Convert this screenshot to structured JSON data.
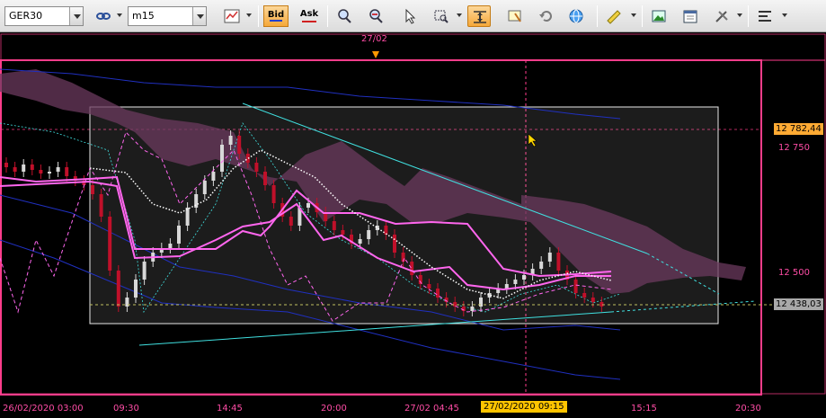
{
  "toolbar": {
    "symbol": "GER30",
    "timeframe": "m15",
    "bid_label": "Bid",
    "ask_label": "Ask",
    "icons": [
      "link-icon",
      "chart-type-icon",
      "crosshair-icon",
      "zoom-in-icon",
      "zoom-out-icon",
      "cursor-icon",
      "zoom-box-icon",
      "scroll-icon",
      "alert-icon",
      "refresh-icon",
      "globe-icon",
      "ruler-icon",
      "image-icon",
      "calendar-icon",
      "tools-icon",
      "indicators-icon"
    ]
  },
  "chart": {
    "top_date": "27/02",
    "price_axis": {
      "current_price_top": "12 782,44",
      "level_12750": "12 750",
      "level_12500": "12 500",
      "current_price_bottom": "12 438,03"
    },
    "time_axis": {
      "labels": [
        "26/02/2020 03:00",
        "09:30",
        "14:45",
        "20:00",
        "27/02 04:45",
        "15:15",
        "20:30"
      ],
      "cursor_time": "27/02/2020 09:15"
    },
    "colors": {
      "frame": "#ff3d8b",
      "cloud": "#6b3a5e",
      "bull": "#d8d8d8",
      "bear": "#c0102a",
      "cyan": "#40e0e0",
      "blue": "#2030c0",
      "pink": "#ff66ee",
      "badge_top": "#ffaa33",
      "badge_bottom": "#a9a9a9"
    }
  }
}
